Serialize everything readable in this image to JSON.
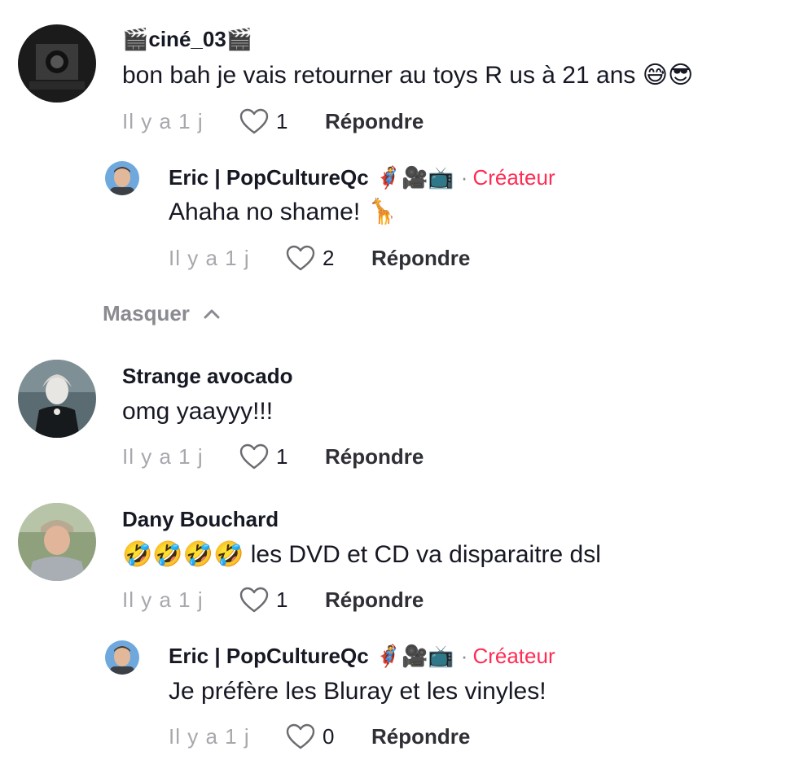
{
  "comments": [
    {
      "username": "ciné_03",
      "name_emoji_left": "🎬",
      "name_emoji_right": "🎬",
      "text": "bon bah je vais retourner au toys R us à 21 ans 😅😎",
      "time": "Il y a 1 j",
      "likes": "1",
      "reply_label": "Répondre"
    },
    {
      "username": "Eric | PopCultureQc",
      "name_emojis": "🦸🎥📺",
      "creator_sep": "·",
      "creator_label": "Créateur",
      "text": "Ahaha no shame! 🦒",
      "time": "Il y a 1 j",
      "likes": "2",
      "reply_label": "Répondre"
    },
    {
      "username": "Strange avocado",
      "text": "omg yaayyy!!!",
      "time": "Il y a 1 j",
      "likes": "1",
      "reply_label": "Répondre"
    },
    {
      "username": "Dany Bouchard",
      "text": "🤣🤣🤣🤣 les DVD et CD va disparaitre dsl",
      "time": "Il y a 1 j",
      "likes": "1",
      "reply_label": "Répondre"
    },
    {
      "username": "Eric | PopCultureQc",
      "name_emojis": "🦸🎥📺",
      "creator_sep": "·",
      "creator_label": "Créateur",
      "text": "Je préfère les Bluray et les vinyles!",
      "time": "Il y a 1 j",
      "likes": "0",
      "reply_label": "Répondre"
    }
  ],
  "hide_replies_label": "Masquer",
  "colors": {
    "creator": "#fe2c55",
    "muted": "#a7a8ad",
    "text": "#161823"
  },
  "icons": {
    "like": "heart-outline-icon",
    "collapse": "chevron-up-icon"
  }
}
